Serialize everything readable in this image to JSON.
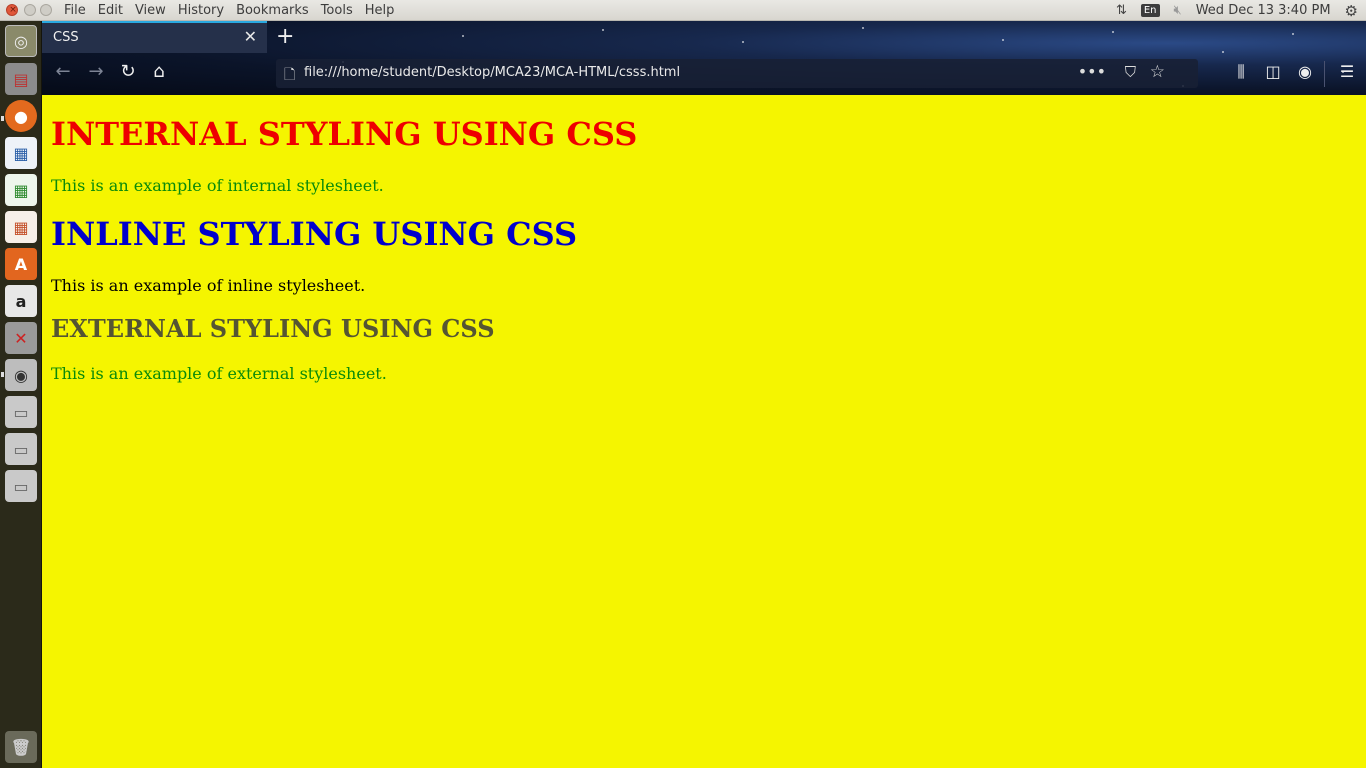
{
  "menubar": {
    "items": [
      "File",
      "Edit",
      "View",
      "History",
      "Bookmarks",
      "Tools",
      "Help"
    ],
    "keyboard_layout": "En",
    "clock": "Wed Dec 13  3:40 PM"
  },
  "launcher": {
    "icons": [
      "ubuntu-dash-icon",
      "file-manager-icon",
      "firefox-icon",
      "writer-icon",
      "calc-icon",
      "impress-icon",
      "software-center-icon",
      "amazon-icon",
      "system-settings-icon",
      "camera-icon",
      "drive-icon",
      "drive-icon",
      "drive-icon",
      "trash-icon"
    ]
  },
  "browser": {
    "tab_title": "CSS",
    "url": "file:///home/student/Desktop/MCA23/MCA-HTML/csss.html",
    "theme_colors": {
      "tab_accent": "#2aa9e0"
    }
  },
  "page": {
    "background": "#f5f500",
    "internal_heading": "INTERNAL STYLING USING CSS",
    "internal_text": "This is an example of internal stylesheet.",
    "inline_heading": "INLINE STYLING USING CSS",
    "inline_text": "This is an example of inline stylesheet.",
    "external_heading": "EXTERNAL STYLING USING CSS",
    "external_text": "This is an example of external stylesheet.",
    "colors": {
      "internal_heading": "#ee0000",
      "internal_text": "#0a8a0a",
      "inline_heading": "#0000cc",
      "inline_text": "#000000",
      "external_heading": "#555533",
      "external_text": "#0a8a0a"
    }
  }
}
